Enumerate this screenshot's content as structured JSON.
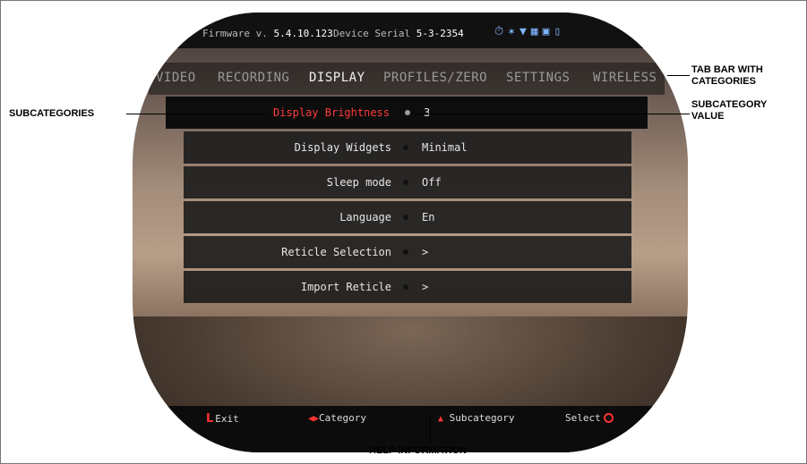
{
  "status": {
    "firmware_label": "Firmware v.",
    "firmware_value": "5.4.10.123",
    "serial_label": "Device Serial",
    "serial_value": "5-3-2354",
    "icons": [
      "timer-icon",
      "bluetooth-icon",
      "wifi-icon",
      "sd-card-icon",
      "camera-icon",
      "battery-icon"
    ]
  },
  "tabs": [
    "VIDEO",
    "RECORDING",
    "DISPLAY",
    "PROFILES/ZERO",
    "SETTINGS",
    "WIRELESS"
  ],
  "active_tab": "DISPLAY",
  "menu": [
    {
      "label": "Display Brightness",
      "value": "3",
      "selected": true
    },
    {
      "label": "Display Widgets",
      "value": "Minimal"
    },
    {
      "label": "Sleep mode",
      "value": "Off"
    },
    {
      "label": "Language",
      "value": "En"
    },
    {
      "label": "Reticle Selection",
      "value": ">"
    },
    {
      "label": "Import Reticle",
      "value": ">"
    }
  ],
  "help": {
    "exit_key": "L",
    "exit": "Exit",
    "category": "Category",
    "subcategory": "Subcategory",
    "select": "Select"
  },
  "callouts": {
    "tab_bar": "TAB BAR WITH CATEGORIES",
    "subcategories": "SUBCATEGORIES",
    "subcategory_value": "SUBCATEGORY VALUE",
    "help_information": "HELP INFORMATION"
  },
  "colors": {
    "highlight": "#ff3b3b",
    "accent_icons": "#7fb4ff"
  }
}
